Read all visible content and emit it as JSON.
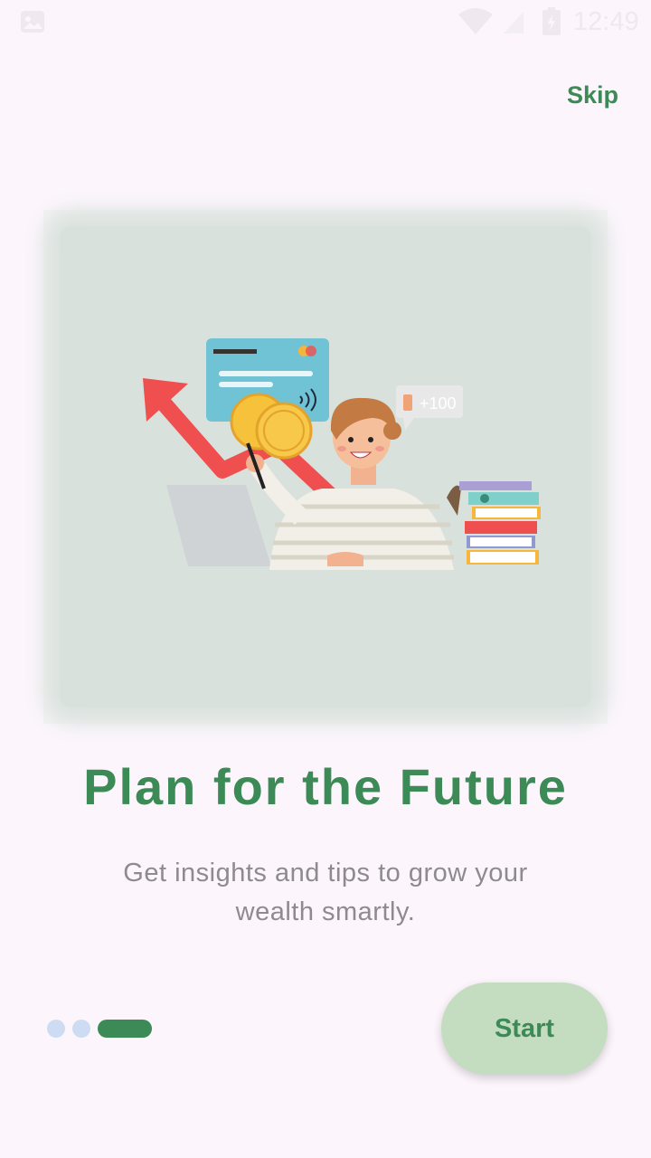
{
  "status_bar": {
    "time": "12:49",
    "icons": [
      "image-icon",
      "wifi-icon",
      "signal-icon",
      "battery-icon"
    ]
  },
  "header": {
    "skip_label": "Skip"
  },
  "hero": {
    "badge_text": "+100",
    "illustration": "finance-growth-illustration"
  },
  "content": {
    "title": "Plan for the Future",
    "subtitle": "Get insights and tips to grow your wealth smartly."
  },
  "pagination": {
    "total": 3,
    "active_index": 2
  },
  "footer": {
    "start_label": "Start"
  },
  "colors": {
    "accent": "#3c8a55",
    "button_bg": "#c4dcc0",
    "background": "#fcf6fc",
    "dot_inactive": "#cddcf2"
  }
}
